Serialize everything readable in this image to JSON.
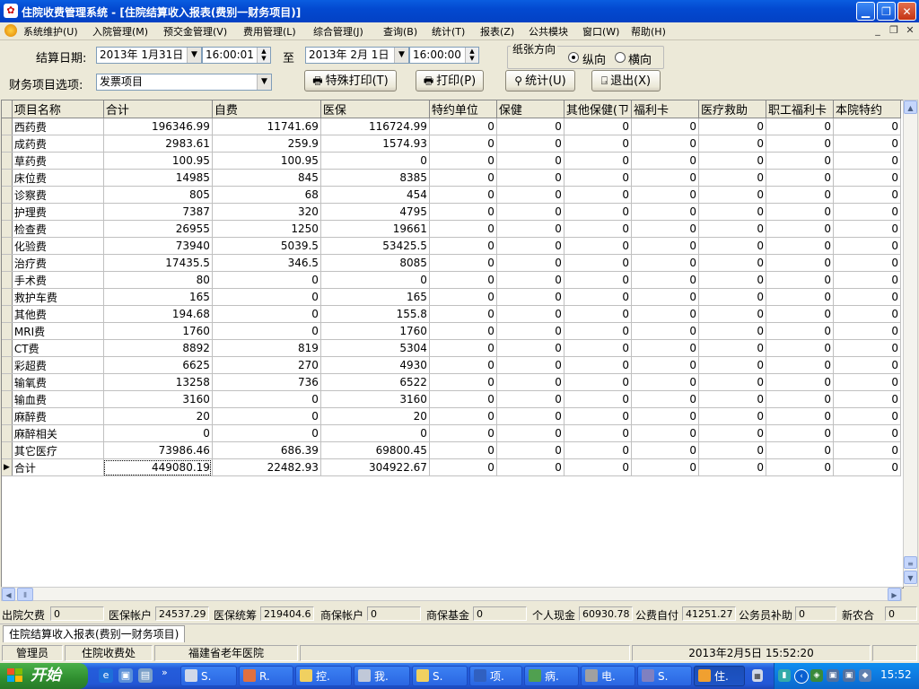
{
  "window": {
    "title": "住院收费管理系统 - [住院结算收入报表(费别一财务项目)]",
    "icon_glyph": "✿"
  },
  "menu": {
    "items": [
      "系统维护(U)",
      "入院管理(M)",
      "预交金管理(V)",
      "费用管理(L)",
      "综合管理(J)",
      "查询(B)",
      "统计(T)",
      "报表(Z)",
      "公共模块",
      "窗口(W)",
      "帮助(H)"
    ]
  },
  "filters": {
    "date_label": "结算日期:",
    "start_date": "2013年 1月31日",
    "start_time": "16:00:01",
    "to_label": "至",
    "end_date": "2013年 2月 1日",
    "end_time": "16:00:00",
    "finance_label": "财务项目选项:",
    "finance_value": "发票项目",
    "orientation_label": "纸张方向",
    "orientation_portrait": "纵向",
    "orientation_landscape": "横向",
    "orientation_selected": "纵向"
  },
  "buttons": {
    "special_print": "特殊打印(T)",
    "print": "打印(P)",
    "stats": "统计(U)",
    "exit": "退出(X)"
  },
  "table": {
    "columns": [
      "项目名称",
      "合计",
      "自费",
      "医保",
      "特约单位",
      "保健",
      "其他保健(ㄗ",
      "福利卡",
      "医疗救助",
      "职工福利卡",
      "本院特约"
    ],
    "rows": [
      [
        "西药费",
        "196346.99",
        "11741.69",
        "116724.99",
        "0",
        "0",
        "0",
        "0",
        "0",
        "0",
        "0"
      ],
      [
        "成药费",
        "2983.61",
        "259.9",
        "1574.93",
        "0",
        "0",
        "0",
        "0",
        "0",
        "0",
        "0"
      ],
      [
        "草药费",
        "100.95",
        "100.95",
        "0",
        "0",
        "0",
        "0",
        "0",
        "0",
        "0",
        "0"
      ],
      [
        "床位费",
        "14985",
        "845",
        "8385",
        "0",
        "0",
        "0",
        "0",
        "0",
        "0",
        "0"
      ],
      [
        "诊察费",
        "805",
        "68",
        "454",
        "0",
        "0",
        "0",
        "0",
        "0",
        "0",
        "0"
      ],
      [
        "护理费",
        "7387",
        "320",
        "4795",
        "0",
        "0",
        "0",
        "0",
        "0",
        "0",
        "0"
      ],
      [
        "检查费",
        "26955",
        "1250",
        "19661",
        "0",
        "0",
        "0",
        "0",
        "0",
        "0",
        "0"
      ],
      [
        "化验费",
        "73940",
        "5039.5",
        "53425.5",
        "0",
        "0",
        "0",
        "0",
        "0",
        "0",
        "0"
      ],
      [
        "治疗费",
        "17435.5",
        "346.5",
        "8085",
        "0",
        "0",
        "0",
        "0",
        "0",
        "0",
        "0"
      ],
      [
        "手术费",
        "80",
        "0",
        "0",
        "0",
        "0",
        "0",
        "0",
        "0",
        "0",
        "0"
      ],
      [
        "救护车费",
        "165",
        "0",
        "165",
        "0",
        "0",
        "0",
        "0",
        "0",
        "0",
        "0"
      ],
      [
        "其他费",
        "194.68",
        "0",
        "155.8",
        "0",
        "0",
        "0",
        "0",
        "0",
        "0",
        "0"
      ],
      [
        "MRI费",
        "1760",
        "0",
        "1760",
        "0",
        "0",
        "0",
        "0",
        "0",
        "0",
        "0"
      ],
      [
        "CT费",
        "8892",
        "819",
        "5304",
        "0",
        "0",
        "0",
        "0",
        "0",
        "0",
        "0"
      ],
      [
        "彩超费",
        "6625",
        "270",
        "4930",
        "0",
        "0",
        "0",
        "0",
        "0",
        "0",
        "0"
      ],
      [
        "输氧费",
        "13258",
        "736",
        "6522",
        "0",
        "0",
        "0",
        "0",
        "0",
        "0",
        "0"
      ],
      [
        "输血费",
        "3160",
        "0",
        "3160",
        "0",
        "0",
        "0",
        "0",
        "0",
        "0",
        "0"
      ],
      [
        "麻醉费",
        "20",
        "0",
        "20",
        "0",
        "0",
        "0",
        "0",
        "0",
        "0",
        "0"
      ],
      [
        "麻醉相关",
        "0",
        "0",
        "0",
        "0",
        "0",
        "0",
        "0",
        "0",
        "0",
        "0"
      ],
      [
        "其它医疗",
        "73986.46",
        "686.39",
        "69800.45",
        "0",
        "0",
        "0",
        "0",
        "0",
        "0",
        "0"
      ],
      [
        " 合计",
        "449080.19",
        "22482.93",
        "304922.67",
        "0",
        "0",
        "0",
        "0",
        "0",
        "0",
        "0"
      ]
    ],
    "current_row_indicator": "▶"
  },
  "summary": [
    {
      "label": "出院欠费",
      "value": "0"
    },
    {
      "label": "医保帐户",
      "value": "24537.29"
    },
    {
      "label": "医保统筹",
      "value": "219404.6"
    },
    {
      "label": "商保帐户",
      "value": "0"
    },
    {
      "label": "商保基金",
      "value": "0"
    },
    {
      "label": "个人现金",
      "value": "60930.78"
    },
    {
      "label": "公费自付",
      "value": "41251.27"
    },
    {
      "label": "公务员补助",
      "value": "0"
    },
    {
      "label": "新农合",
      "value": "0"
    }
  ],
  "doc_tab": "住院结算收入报表(费别一财务项目)",
  "status": {
    "user": "管理员",
    "dept": "住院收费处",
    "hospital": "福建省老年医院",
    "datetime": "2013年2月5日  15:52:20"
  },
  "taskbar": {
    "start_label": "开始",
    "tasks": [
      "S.",
      "R.",
      "控.",
      "我.",
      "S.",
      "项.",
      "病.",
      "电.",
      "S.",
      "住."
    ],
    "clock": "15:52"
  },
  "colors": {
    "titlebar": "#0349d0",
    "taskbar": "#245ddb",
    "start": "#2f8e2f",
    "grid_header": "#ece9d8"
  }
}
